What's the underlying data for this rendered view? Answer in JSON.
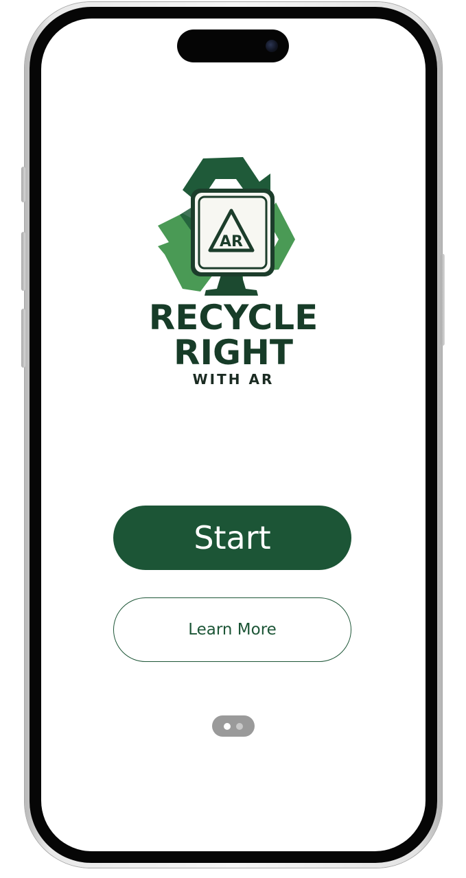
{
  "brand": {
    "logo_icon": "recycle-ar-monitor-icon",
    "logo_badge_text": "AR",
    "title_line1": "RECYCLE",
    "title_line2": "RIGHT",
    "subtitle": "WITH AR"
  },
  "actions": {
    "start_label": "Start",
    "learn_more_label": "Learn More"
  },
  "pagination": {
    "total_pages": 2,
    "current_page": 1
  },
  "colors": {
    "primary": "#1c5536",
    "title": "#173c28",
    "arrow_dark": "#1f5a39",
    "arrow_light": "#4a9a55"
  }
}
